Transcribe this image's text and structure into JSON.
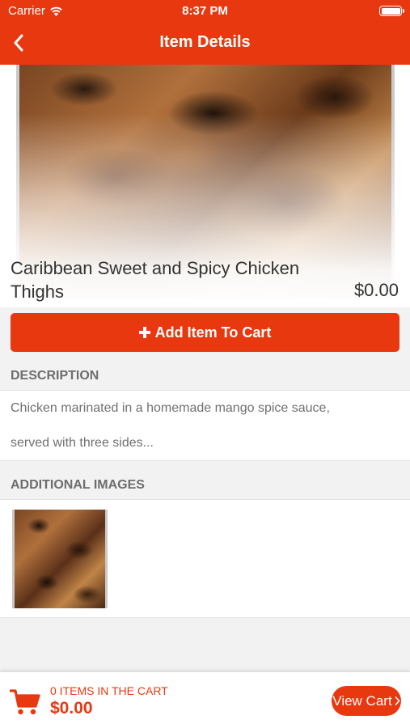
{
  "status_bar": {
    "carrier": "Carrier",
    "time": "8:37 PM"
  },
  "nav": {
    "title": "Item Details",
    "back_icon": "chevron-left-icon"
  },
  "item": {
    "name": "Caribbean Sweet and Spicy Chicken Thighs",
    "price": "$0.00"
  },
  "actions": {
    "add_to_cart_label": "Add Item To Cart",
    "add_icon": "plus-icon"
  },
  "description": {
    "header": "DESCRIPTION",
    "line1": "Chicken marinated in a homemade mango spice sauce,",
    "line2": "served with three sides..."
  },
  "additional_images": {
    "header": "ADDITIONAL IMAGES"
  },
  "cart": {
    "count_text": "0 ITEMS IN THE CART",
    "total": "$0.00",
    "view_cart_label": "View Cart"
  },
  "colors": {
    "accent": "#e8380f",
    "section_bg": "#f2f2f2",
    "text_muted": "#6d6d6d"
  }
}
